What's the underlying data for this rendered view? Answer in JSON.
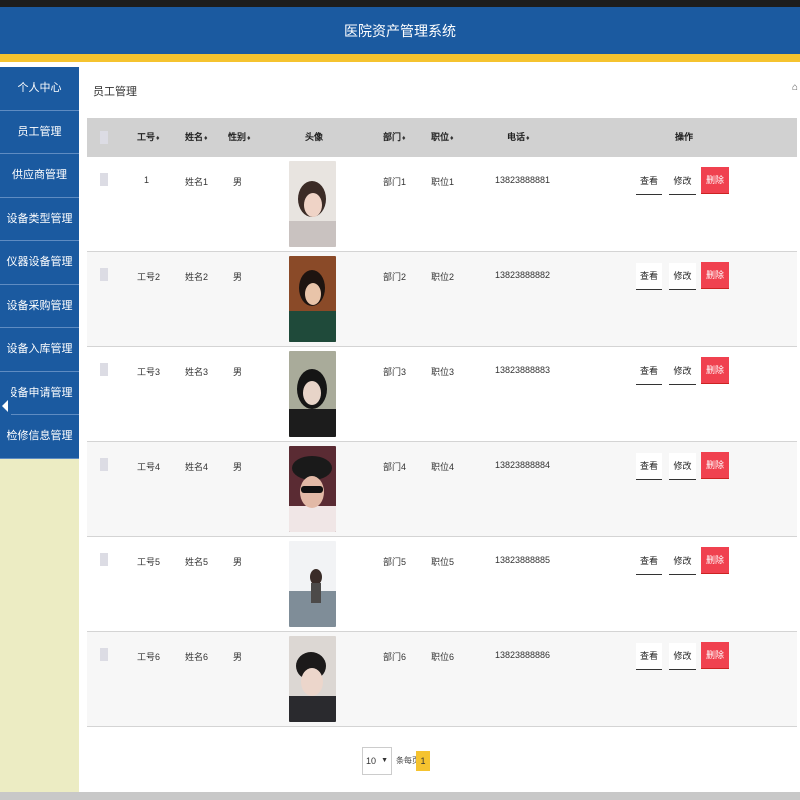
{
  "app": {
    "title": "医院资产管理系统"
  },
  "sidebar": {
    "items": [
      {
        "label": "个人中心"
      },
      {
        "label": "员工管理"
      },
      {
        "label": "供应商管理"
      },
      {
        "label": "设备类型管理"
      },
      {
        "label": "仪器设备管理"
      },
      {
        "label": "设备采购管理"
      },
      {
        "label": "设备入库管理"
      },
      {
        "label": "设备申请管理"
      },
      {
        "label": "检修信息管理"
      }
    ]
  },
  "breadcrumb": {
    "current": "员工管理"
  },
  "table": {
    "headers": {
      "id": "工号",
      "name": "姓名",
      "gender": "性别",
      "avatar": "头像",
      "dept": "部门",
      "position": "职位",
      "phone": "电话",
      "actions": "操作"
    },
    "rows": [
      {
        "id": "1",
        "name": "姓名1",
        "gender": "男",
        "dept": "部门1",
        "position": "职位1",
        "phone": "13823888881"
      },
      {
        "id": "工号2",
        "name": "姓名2",
        "gender": "男",
        "dept": "部门2",
        "position": "职位2",
        "phone": "13823888882"
      },
      {
        "id": "工号3",
        "name": "姓名3",
        "gender": "男",
        "dept": "部门3",
        "position": "职位3",
        "phone": "13823888883"
      },
      {
        "id": "工号4",
        "name": "姓名4",
        "gender": "男",
        "dept": "部门4",
        "position": "职位4",
        "phone": "13823888884"
      },
      {
        "id": "工号5",
        "name": "姓名5",
        "gender": "男",
        "dept": "部门5",
        "position": "职位5",
        "phone": "13823888885"
      },
      {
        "id": "工号6",
        "name": "姓名6",
        "gender": "男",
        "dept": "部门6",
        "position": "职位6",
        "phone": "13823888886"
      }
    ],
    "buttons": {
      "view": "查看",
      "edit": "修改",
      "delete": "删除"
    }
  },
  "pagination": {
    "page_size": "10",
    "per_page_label": "条每页",
    "current_page": "1"
  },
  "colors": {
    "header_bg": "#1b5aa0",
    "accent_yellow": "#f5c32f",
    "delete_red": "#f0414f",
    "sidebar_bg": "#ececc3"
  },
  "icons": {
    "home": "home-icon",
    "sort": "sort-icon",
    "collapse": "chevron-left-icon"
  }
}
